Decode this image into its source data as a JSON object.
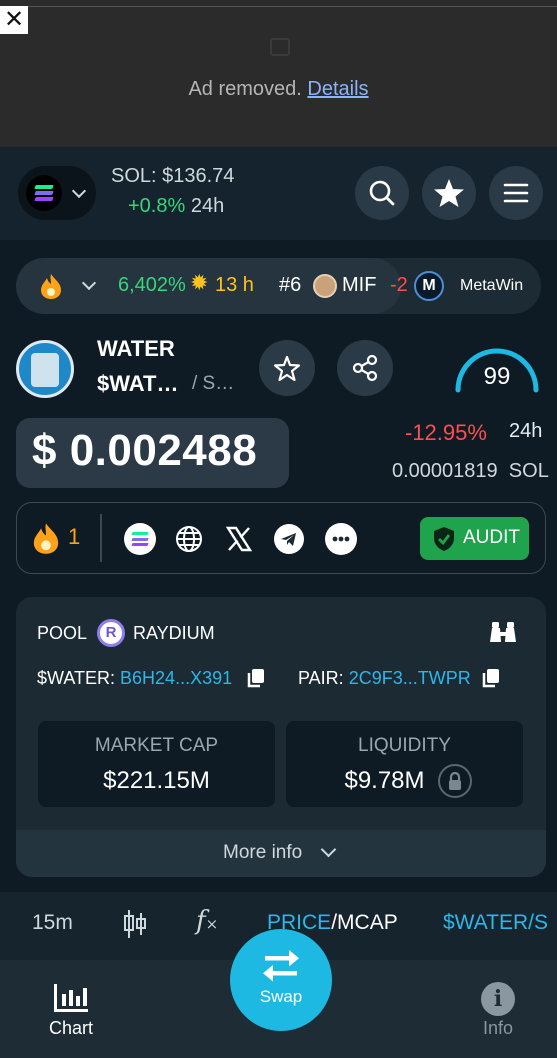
{
  "ad": {
    "close_glyph": "✕",
    "text": "Ad removed.",
    "link": "Details"
  },
  "header": {
    "sol_price": "SOL: $136.74",
    "sol_change": "+0.8%",
    "sol_period": "24h"
  },
  "trending": {
    "gain": "6,402%",
    "time": "13 h",
    "rank": "#6",
    "name": "MIF",
    "partial": "-2",
    "sponsor": "MetaWin"
  },
  "token": {
    "name": "WATER",
    "symbol": "$WAT…",
    "chain": "/ S…",
    "score": "99",
    "price": "$ 0.002488",
    "change": "-12.95%",
    "period": "24h",
    "sol_value": "0.00001819",
    "sol_unit": "SOL"
  },
  "social": {
    "fire_count": "1",
    "audit_label": "AUDIT"
  },
  "pool": {
    "pool_label": "POOL",
    "dex": "RAYDIUM",
    "token_label": "$WATER:",
    "token_addr": "B6H24...X391",
    "pair_label": "PAIR:",
    "pair_addr": "2C9F3...TWPR",
    "mcap_label": "MARKET CAP",
    "mcap_value": "$221.15M",
    "liq_label": "LIQUIDITY",
    "liq_value": "$9.78M",
    "more_info": "More info"
  },
  "chart_toolbar": {
    "interval": "15m",
    "price": "PRICE",
    "slash": "/",
    "mcap": "MCAP",
    "pair": "$WATER/S"
  },
  "nav": {
    "chart": "Chart",
    "swap": "Swap",
    "info": "Info"
  },
  "colors": {
    "accent": "#1eb9e3",
    "green": "#37d67a",
    "red": "#ff4d4d",
    "link": "#2fb6e8"
  }
}
